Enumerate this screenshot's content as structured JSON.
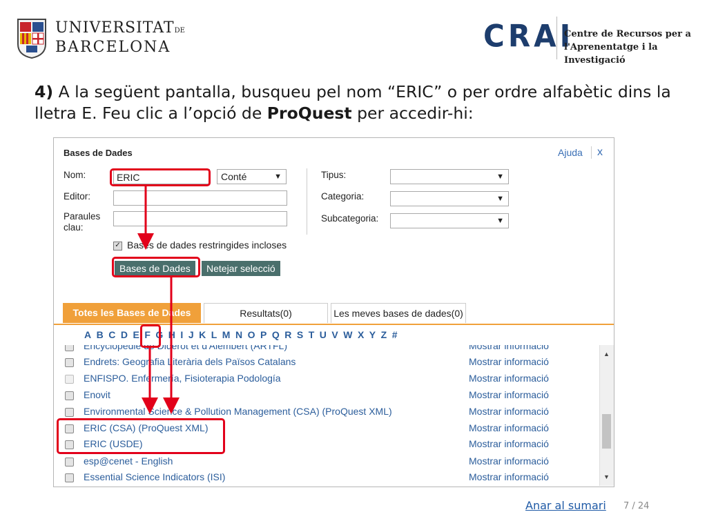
{
  "header": {
    "university_line1": "UNIVERSITAT",
    "university_de": "DE",
    "university_line2": "BARCELONA",
    "crai_logo": "CRAI",
    "crai_text_line1": "Centre de Recursos per a",
    "crai_text_line2": "l'Aprenentatge i la Investigació"
  },
  "instruction": {
    "step": "4)",
    "text_a": " A la següent pantalla, busqueu pel nom “ERIC” o per ordre alfabètic dins la lletra E. Feu clic a l’opció de ",
    "emphasis": "ProQuest",
    "text_b": " per accedir-hi:"
  },
  "panel": {
    "title": "Bases de Dades",
    "help_link": "Ajuda",
    "close": "x",
    "labels": {
      "nom": "Nom:",
      "editor": "Editor:",
      "paraules": "Paraules clau:",
      "tipus": "Tipus:",
      "categoria": "Categoria:",
      "subcategoria": "Subcategoria:"
    },
    "nom_value": "ERIC",
    "match_select": "Conté",
    "editor_value": "",
    "paraules_value": "",
    "tipus_value": "",
    "categoria_value": "",
    "subcategoria_value": "",
    "checkbox_label": "Bases de dades restringides incloses",
    "checkbox_checked": true,
    "btn_search": "Bases de Dades",
    "btn_clear": "Netejar selecció",
    "tabs": [
      "Totes les Bases de Dades",
      "Resultats(0)",
      "Les meves bases de dades(0)"
    ],
    "letters": [
      "A",
      "B",
      "C",
      "D",
      "E",
      "F",
      "G",
      "H",
      "I",
      "J",
      "K",
      "L",
      "M",
      "N",
      "O",
      "P",
      "Q",
      "R",
      "S",
      "T",
      "U",
      "V",
      "W",
      "X",
      "Y",
      "Z",
      "#"
    ],
    "rows": [
      {
        "name": "Encyclopédie de Diderot et d'Alembert (ARTFL)",
        "info": "Mostrar informació"
      },
      {
        "name": "Endrets: Geografia Literària dels Països Catalans",
        "info": "Mostrar informació"
      },
      {
        "name": "ENFISPO. Enfermería, Fisioterapia Podología",
        "info": "Mostrar informació"
      },
      {
        "name": "Enovit",
        "info": "Mostrar informació"
      },
      {
        "name": "Environmental Science & Pollution Management (CSA) (ProQuest XML)",
        "info": "Mostrar informació"
      },
      {
        "name": "ERIC (CSA) (ProQuest XML)",
        "info": "Mostrar informació"
      },
      {
        "name": "ERIC (USDE)",
        "info": "Mostrar informació"
      },
      {
        "name": "esp@cenet - English",
        "info": "Mostrar informació"
      },
      {
        "name": "Essential Science Indicators (ISI)",
        "info": "Mostrar informació"
      }
    ]
  },
  "footer": {
    "sumari_link": "Anar al sumari",
    "page_number": "7 / 24"
  },
  "colors": {
    "accent_orange": "#f0a03a",
    "link_blue": "#2b5d9b",
    "highlight_red": "#e2001a",
    "crai_blue": "#1d3d6d",
    "button_teal": "#4a6f6c"
  }
}
